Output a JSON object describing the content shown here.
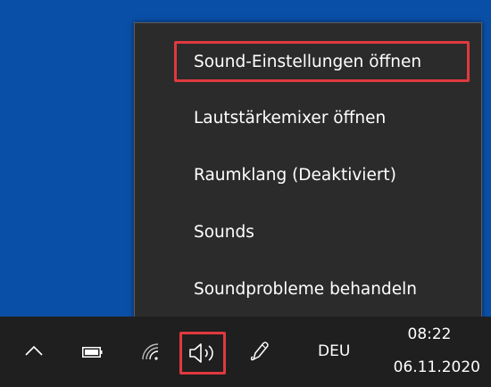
{
  "context_menu": {
    "items": [
      {
        "label": "Sound-Einstellungen öffnen"
      },
      {
        "label": "Lautstärkemixer öffnen"
      },
      {
        "label": "Raumklang (Deaktiviert)"
      },
      {
        "label": "Sounds"
      },
      {
        "label": "Soundprobleme behandeln"
      }
    ]
  },
  "taskbar": {
    "tray_icons": [
      "chevron-up-icon",
      "battery-icon",
      "wifi-icon",
      "speaker-icon",
      "pen-icon"
    ],
    "language": "DEU",
    "time": "08:22",
    "date": "06.11.2020"
  },
  "colors": {
    "desktop": "#0a4fa7",
    "menu_background": "#2b2b2b",
    "taskbar": "#1f1f1f",
    "highlight": "#e0393e"
  }
}
